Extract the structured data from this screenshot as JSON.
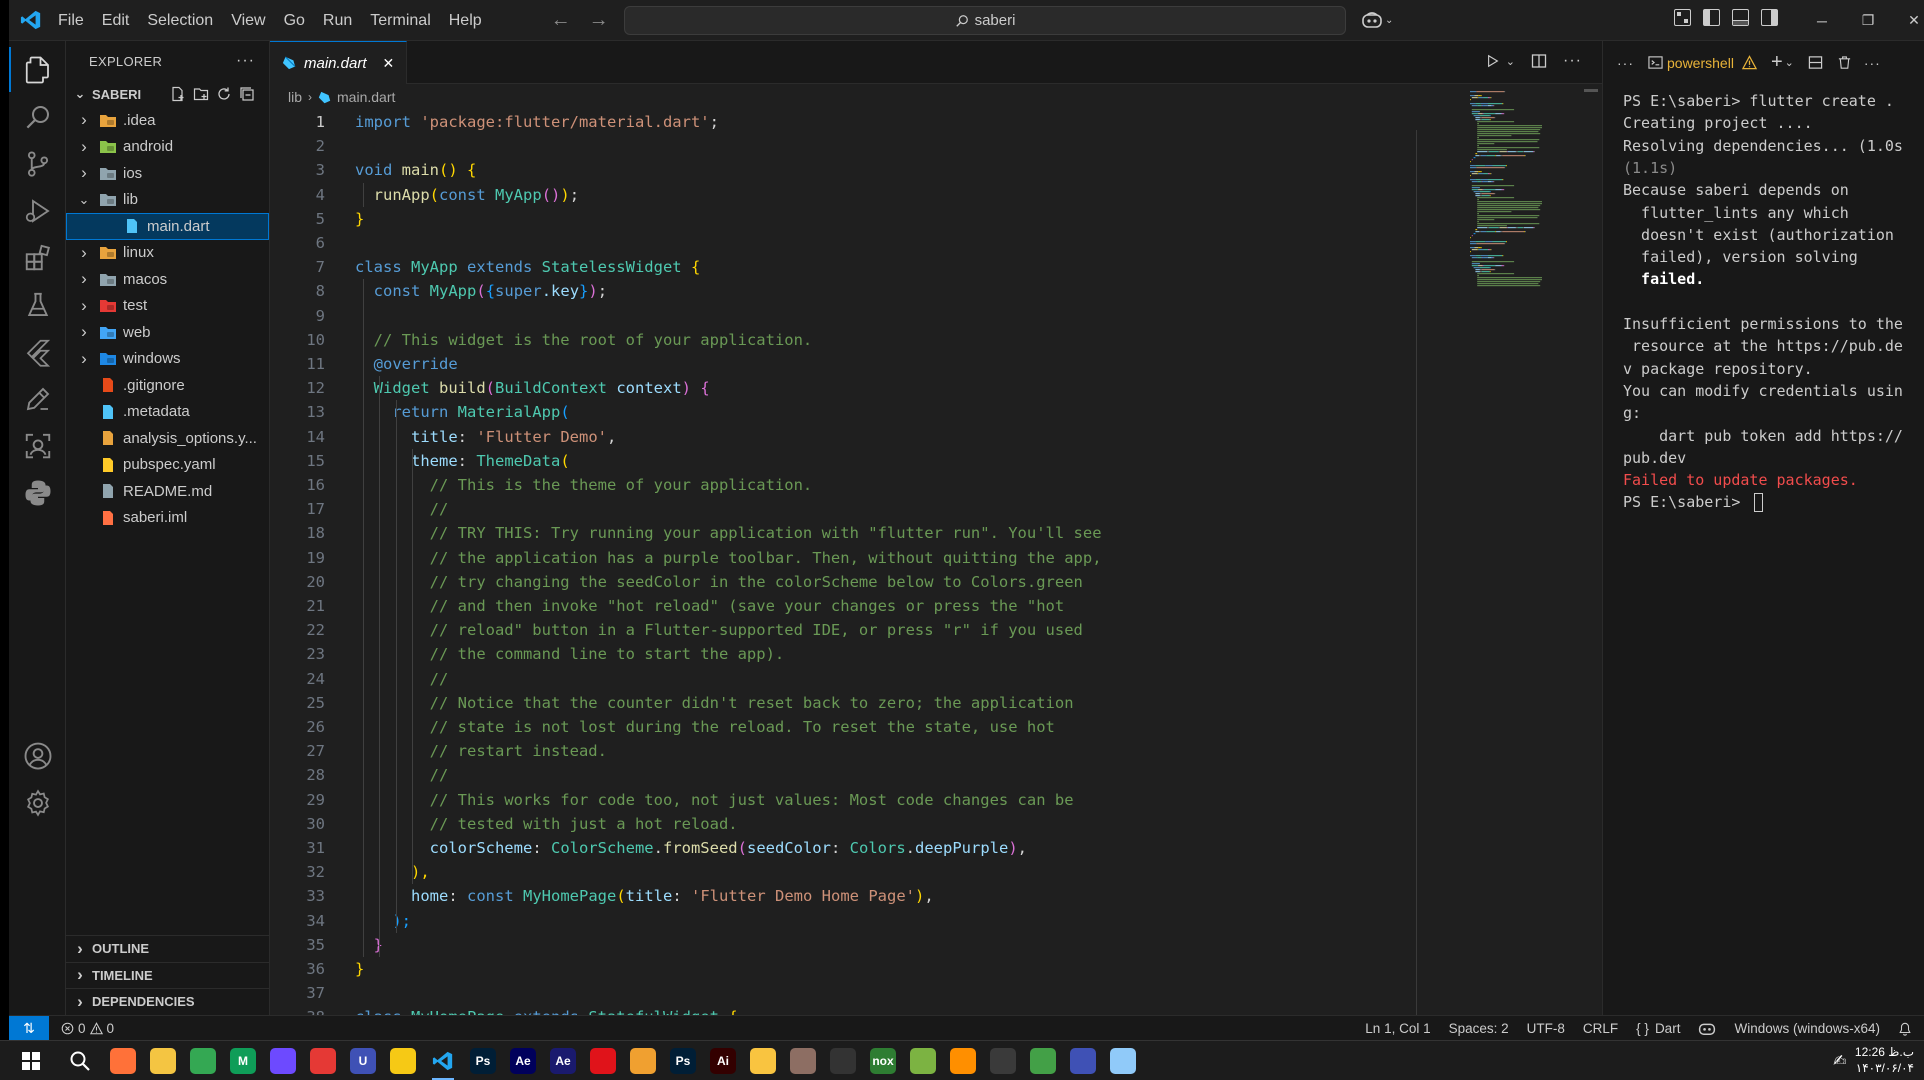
{
  "titlebar": {
    "menu": [
      "File",
      "Edit",
      "Selection",
      "View",
      "Go",
      "Run",
      "Terminal",
      "Help"
    ],
    "search_text": "saberi"
  },
  "sidebar": {
    "title": "EXPLORER",
    "folder": "SABERI",
    "items": [
      {
        "label": ".idea",
        "type": "folder",
        "depth": 0,
        "icon": "idea-folder-icon",
        "color": "#e8a33d"
      },
      {
        "label": "android",
        "type": "folder",
        "depth": 0,
        "icon": "android-folder-icon",
        "color": "#8bc34a"
      },
      {
        "label": "ios",
        "type": "folder",
        "depth": 0,
        "icon": "ios-folder-icon",
        "color": "#90a4ae"
      },
      {
        "label": "lib",
        "type": "folder-open",
        "depth": 0,
        "icon": "lib-folder-icon",
        "color": "#90a4ae"
      },
      {
        "label": "main.dart",
        "type": "file",
        "depth": 1,
        "icon": "dart-file-icon",
        "color": "#4fc3f7",
        "selected": true
      },
      {
        "label": "linux",
        "type": "folder",
        "depth": 0,
        "icon": "linux-folder-icon",
        "color": "#e8a33d"
      },
      {
        "label": "macos",
        "type": "folder",
        "depth": 0,
        "icon": "macos-folder-icon",
        "color": "#90a4ae"
      },
      {
        "label": "test",
        "type": "folder",
        "depth": 0,
        "icon": "test-folder-icon",
        "color": "#e53935"
      },
      {
        "label": "web",
        "type": "folder",
        "depth": 0,
        "icon": "web-folder-icon",
        "color": "#42a5f5"
      },
      {
        "label": "windows",
        "type": "folder",
        "depth": 0,
        "icon": "windows-folder-icon",
        "color": "#1e88e5"
      },
      {
        "label": ".gitignore",
        "type": "file",
        "depth": 0,
        "icon": "git-file-icon",
        "color": "#e64a19"
      },
      {
        "label": ".metadata",
        "type": "file",
        "depth": 0,
        "icon": "flutter-file-icon",
        "color": "#4fc3f7"
      },
      {
        "label": "analysis_options.y...",
        "type": "file",
        "depth": 0,
        "icon": "yaml-file-icon",
        "color": "#e8a33d"
      },
      {
        "label": "pubspec.yaml",
        "type": "file",
        "depth": 0,
        "icon": "pubspec-file-icon",
        "color": "#ffca28"
      },
      {
        "label": "README.md",
        "type": "file",
        "depth": 0,
        "icon": "markdown-file-icon",
        "color": "#90a4ae"
      },
      {
        "label": "saberi.iml",
        "type": "file",
        "depth": 0,
        "icon": "xml-file-icon",
        "color": "#ff7043"
      }
    ],
    "sections": [
      "OUTLINE",
      "TIMELINE",
      "DEPENDENCIES"
    ]
  },
  "editor": {
    "tab": "main.dart",
    "breadcrumb": [
      "lib",
      "main.dart"
    ],
    "current_line": 1,
    "lines": [
      [
        [
          "import ",
          "kw"
        ],
        [
          "'package:flutter/material.dart'",
          "st"
        ],
        [
          ";",
          "pl"
        ]
      ],
      [],
      [
        [
          "void ",
          "kw"
        ],
        [
          "main",
          "fn"
        ],
        [
          "() ",
          "b1"
        ],
        [
          "{",
          "b1"
        ]
      ],
      [
        [
          "  ",
          "pl"
        ],
        [
          "runApp",
          "fn"
        ],
        [
          "(",
          "b1"
        ],
        [
          "const ",
          "kw"
        ],
        [
          "MyApp",
          "ty"
        ],
        [
          "()",
          "b2"
        ],
        [
          ")",
          "b1"
        ],
        [
          ";",
          "pl"
        ]
      ],
      [
        [
          "}",
          "b1"
        ]
      ],
      [],
      [
        [
          "class ",
          "kw"
        ],
        [
          "MyApp ",
          "ty"
        ],
        [
          "extends ",
          "kw"
        ],
        [
          "StatelessWidget ",
          "ty"
        ],
        [
          "{",
          "b1"
        ]
      ],
      [
        [
          "  ",
          "pl"
        ],
        [
          "const ",
          "kw"
        ],
        [
          "MyApp",
          "ty"
        ],
        [
          "(",
          "b2"
        ],
        [
          "{",
          "b3"
        ],
        [
          "super",
          "kw"
        ],
        [
          ".key",
          "vr"
        ],
        [
          "}",
          "b3"
        ],
        [
          ")",
          "b2"
        ],
        [
          ";",
          "pl"
        ]
      ],
      [],
      [
        [
          "  ",
          "pl"
        ],
        [
          "// This widget is the root of your application.",
          "cm"
        ]
      ],
      [
        [
          "  ",
          "pl"
        ],
        [
          "@override",
          "an"
        ]
      ],
      [
        [
          "  ",
          "pl"
        ],
        [
          "Widget ",
          "ty"
        ],
        [
          "build",
          "fn"
        ],
        [
          "(",
          "b2"
        ],
        [
          "BuildContext ",
          "ty"
        ],
        [
          "context",
          "vr"
        ],
        [
          ") ",
          "b2"
        ],
        [
          "{",
          "b2"
        ]
      ],
      [
        [
          "    ",
          "pl"
        ],
        [
          "return ",
          "kw"
        ],
        [
          "MaterialApp",
          "ty"
        ],
        [
          "(",
          "b3"
        ]
      ],
      [
        [
          "      ",
          "pl"
        ],
        [
          "title",
          "vr"
        ],
        [
          ": ",
          "pl"
        ],
        [
          "'Flutter Demo'",
          "st"
        ],
        [
          ",",
          "pl"
        ]
      ],
      [
        [
          "      ",
          "pl"
        ],
        [
          "theme",
          "vr"
        ],
        [
          ": ",
          "pl"
        ],
        [
          "ThemeData",
          "ty"
        ],
        [
          "(",
          "b1"
        ]
      ],
      [
        [
          "        ",
          "pl"
        ],
        [
          "// This is the theme of your application.",
          "cm"
        ]
      ],
      [
        [
          "        ",
          "pl"
        ],
        [
          "//",
          "cm"
        ]
      ],
      [
        [
          "        ",
          "pl"
        ],
        [
          "// TRY THIS: Try running your application with \"flutter run\". You'll see",
          "cm"
        ]
      ],
      [
        [
          "        ",
          "pl"
        ],
        [
          "// the application has a purple toolbar. Then, without quitting the app,",
          "cm"
        ]
      ],
      [
        [
          "        ",
          "pl"
        ],
        [
          "// try changing the seedColor in the colorScheme below to Colors.green",
          "cm"
        ]
      ],
      [
        [
          "        ",
          "pl"
        ],
        [
          "// and then invoke \"hot reload\" (save your changes or press the \"hot",
          "cm"
        ]
      ],
      [
        [
          "        ",
          "pl"
        ],
        [
          "// reload\" button in a Flutter-supported IDE, or press \"r\" if you used",
          "cm"
        ]
      ],
      [
        [
          "        ",
          "pl"
        ],
        [
          "// the command line to start the app).",
          "cm"
        ]
      ],
      [
        [
          "        ",
          "pl"
        ],
        [
          "//",
          "cm"
        ]
      ],
      [
        [
          "        ",
          "pl"
        ],
        [
          "// Notice that the counter didn't reset back to zero; the application",
          "cm"
        ]
      ],
      [
        [
          "        ",
          "pl"
        ],
        [
          "// state is not lost during the reload. To reset the state, use hot",
          "cm"
        ]
      ],
      [
        [
          "        ",
          "pl"
        ],
        [
          "// restart instead.",
          "cm"
        ]
      ],
      [
        [
          "        ",
          "pl"
        ],
        [
          "//",
          "cm"
        ]
      ],
      [
        [
          "        ",
          "pl"
        ],
        [
          "// This works for code too, not just values: Most code changes can be",
          "cm"
        ]
      ],
      [
        [
          "        ",
          "pl"
        ],
        [
          "// tested with just a hot reload.",
          "cm"
        ]
      ],
      [
        [
          "        ",
          "pl"
        ],
        [
          "colorScheme",
          "vr"
        ],
        [
          ": ",
          "pl"
        ],
        [
          "ColorScheme",
          "ty"
        ],
        [
          ".",
          "pl"
        ],
        [
          "fromSeed",
          "fn"
        ],
        [
          "(",
          "b2"
        ],
        [
          "seedColor",
          "vr"
        ],
        [
          ": ",
          "pl"
        ],
        [
          "Colors",
          "ty"
        ],
        [
          ".",
          "pl"
        ],
        [
          "deepPurple",
          "vr"
        ],
        [
          ")",
          "b2"
        ],
        [
          ",",
          "pl"
        ]
      ],
      [
        [
          "      ",
          "pl"
        ],
        [
          "),",
          "b1"
        ]
      ],
      [
        [
          "      ",
          "pl"
        ],
        [
          "home",
          "vr"
        ],
        [
          ": ",
          "pl"
        ],
        [
          "const ",
          "kw"
        ],
        [
          "MyHomePage",
          "ty"
        ],
        [
          "(",
          "b1"
        ],
        [
          "title",
          "vr"
        ],
        [
          ": ",
          "pl"
        ],
        [
          "'Flutter Demo Home Page'",
          "st"
        ],
        [
          ")",
          "b1"
        ],
        [
          ",",
          "pl"
        ]
      ],
      [
        [
          "    ",
          "pl"
        ],
        [
          ");",
          "b3"
        ]
      ],
      [
        [
          "  ",
          "pl"
        ],
        [
          "}",
          "b2"
        ]
      ],
      [
        [
          "}",
          "b1"
        ]
      ],
      [],
      [
        [
          "class ",
          "kw"
        ],
        [
          "MyHomePage ",
          "ty"
        ],
        [
          "extends ",
          "kw"
        ],
        [
          "StatefulWidget ",
          "ty"
        ],
        [
          "{",
          "b1"
        ]
      ]
    ]
  },
  "terminal": {
    "shell": "powershell",
    "lines": [
      {
        "t": "PS E:\\saberi> flutter create .",
        "c": "#cccccc"
      },
      {
        "t": "Creating project ....",
        "c": "#cccccc"
      },
      {
        "t": "Resolving dependencies... (1.0s",
        "c": "#cccccc"
      },
      {
        "t": "(1.1s)",
        "c": "#8b8b8b"
      },
      {
        "t": "Because saberi depends on",
        "c": "#cccccc"
      },
      {
        "t": "  flutter_lints any which",
        "c": "#cccccc"
      },
      {
        "t": "  doesn't exist (authorization",
        "c": "#cccccc"
      },
      {
        "t": "  failed), version solving",
        "c": "#cccccc"
      },
      {
        "t": "  failed.",
        "c": "#ffffff",
        "bold": true
      },
      {
        "t": "",
        "c": "#cccccc"
      },
      {
        "t": "Insufficient permissions to the",
        "c": "#cccccc"
      },
      {
        "t": " resource at the https://pub.de",
        "c": "#cccccc"
      },
      {
        "t": "v package repository.",
        "c": "#cccccc"
      },
      {
        "t": "You can modify credentials usin",
        "c": "#cccccc"
      },
      {
        "t": "g:",
        "c": "#cccccc"
      },
      {
        "t": "    dart pub token add https://",
        "c": "#cccccc"
      },
      {
        "t": "pub.dev",
        "c": "#cccccc"
      },
      {
        "t": "Failed to update packages.",
        "c": "#f14c4c"
      },
      {
        "t": "PS E:\\saberi> ",
        "c": "#cccccc"
      }
    ]
  },
  "statusbar": {
    "errors": "0",
    "warnings": "0",
    "position": "Ln 1, Col 1",
    "spaces": "Spaces: 2",
    "encoding": "UTF-8",
    "eol": "CRLF",
    "language": "Dart",
    "device": "Windows (windows-x64)"
  },
  "taskbar": {
    "time": "12:26 ب.ظ",
    "date": "۱۴۰۳/۰۶/۰۴",
    "apps": [
      {
        "name": "firefox-icon",
        "color": "#ff7139",
        "label": ""
      },
      {
        "name": "file-explorer-icon",
        "color": "#f4c542",
        "label": ""
      },
      {
        "name": "chrome-icon",
        "color": "#34a853",
        "label": ""
      },
      {
        "name": "mail-app-icon",
        "color": "#0f9d58",
        "label": "M"
      },
      {
        "name": "proton-vpn-icon",
        "color": "#6d4aff",
        "label": ""
      },
      {
        "name": "media-player-icon",
        "color": "#e53935",
        "label": ""
      },
      {
        "name": "u-app-icon",
        "color": "#3f51b5",
        "label": "U"
      },
      {
        "name": "potplayer-icon",
        "color": "#f6c915",
        "label": ""
      },
      {
        "name": "vscode-icon",
        "color": "#007acc",
        "label": ""
      },
      {
        "name": "photoshop-icon",
        "color": "#001e36",
        "label": "Ps"
      },
      {
        "name": "after-effects-icon",
        "color": "#00005b",
        "label": "Ae"
      },
      {
        "name": "after-effects-2-icon",
        "color": "#1a1a6e",
        "label": "Ae"
      },
      {
        "name": "opera-icon",
        "color": "#e0131a",
        "label": ""
      },
      {
        "name": "media-app-icon",
        "color": "#f0a030",
        "label": ""
      },
      {
        "name": "photoshop-2-icon",
        "color": "#001e36",
        "label": "Ps"
      },
      {
        "name": "illustrator-icon",
        "color": "#330000",
        "label": "Ai"
      },
      {
        "name": "emoji-app-icon",
        "color": "#f9c440",
        "label": ""
      },
      {
        "name": "tool-app-icon",
        "color": "#8d6e63",
        "label": ""
      },
      {
        "name": "diamond-app-icon",
        "color": "#333333",
        "label": ""
      },
      {
        "name": "nox-player-icon",
        "color": "#2e7d32",
        "label": "nox"
      },
      {
        "name": "bluestacks-icon",
        "color": "#7cb342",
        "label": ""
      },
      {
        "name": "orange-app-icon",
        "color": "#ff8f00",
        "label": ""
      },
      {
        "name": "calculator-icon",
        "color": "#3a3a3a",
        "label": ""
      },
      {
        "name": "network-app-icon",
        "color": "#43a047",
        "label": ""
      },
      {
        "name": "chart-app-icon",
        "color": "#3f51b5",
        "label": ""
      },
      {
        "name": "paint-app-icon",
        "color": "#90caf9",
        "label": ""
      }
    ]
  }
}
